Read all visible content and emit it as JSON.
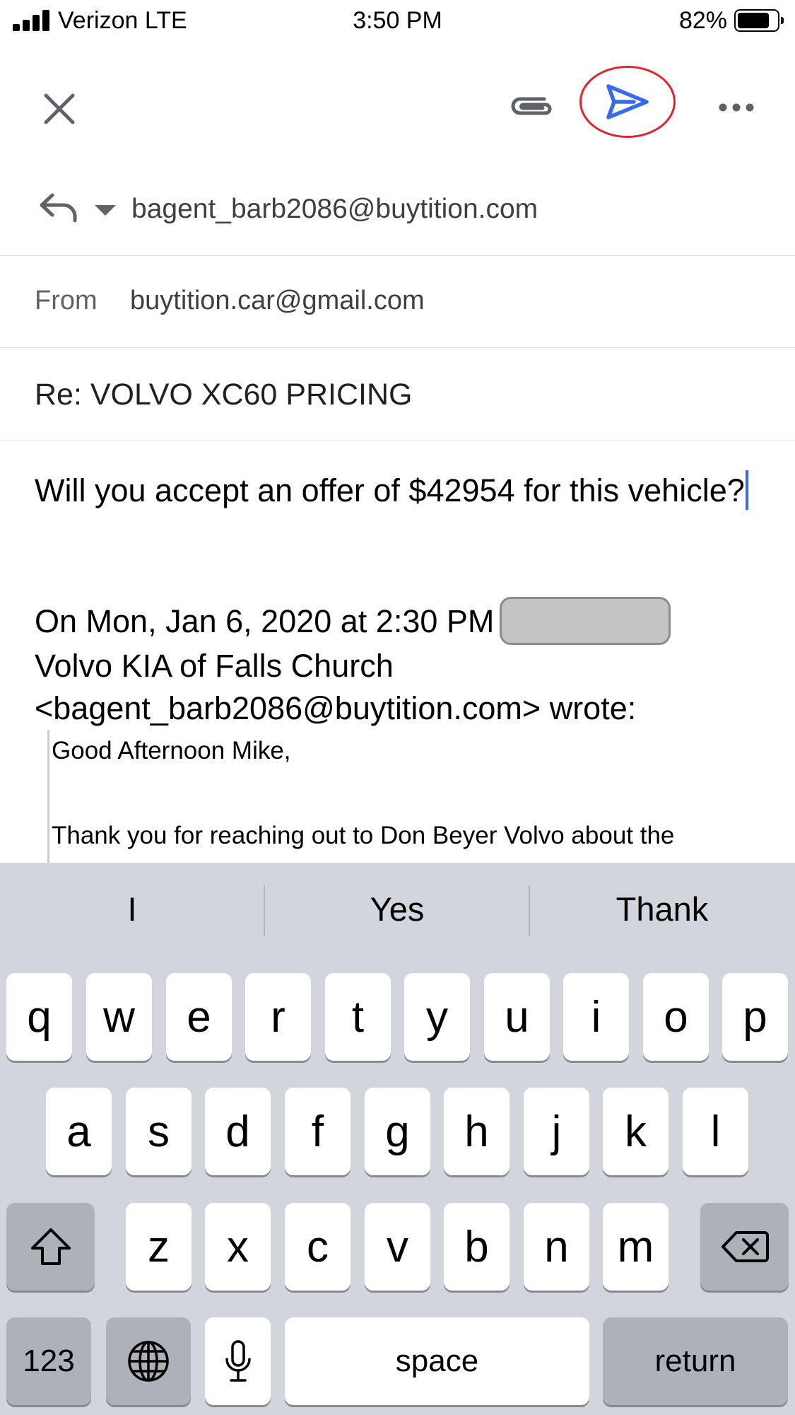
{
  "status_bar": {
    "carrier": "Verizon  LTE",
    "time": "3:50 PM",
    "battery_percent": "82%",
    "battery_level": 0.82,
    "icons": [
      "signal-bars-icon",
      "battery-icon"
    ]
  },
  "toolbar": {
    "icons": [
      "close-icon",
      "attachment-icon",
      "send-icon",
      "more-icon"
    ],
    "accent_color": "#3b6ae8",
    "highlight_color": "#e0242f"
  },
  "compose": {
    "to": "bagent_barb2086@buytition.com",
    "from_label": "From",
    "from": "buytition.car@gmail.com",
    "subject": "Re: VOLVO XC60 PRICING",
    "body": "Will you accept an offer of $42954 for this vehicle?",
    "quote_header_line1": "On Mon, Jan 6, 2020 at 2:30 PM",
    "quote_header_line2": "Volvo KIA of Falls Church",
    "quote_header_line3": "<bagent_barb2086@buytition.com> wrote:",
    "quoted_lines": [
      "Good Afternoon Mike,",
      "Thank you for reaching out to Don Beyer Volvo about the"
    ]
  },
  "keyboard": {
    "suggestions": [
      "I",
      "Yes",
      "Thank"
    ],
    "row1": [
      "q",
      "w",
      "e",
      "r",
      "t",
      "y",
      "u",
      "i",
      "o",
      "p"
    ],
    "row2": [
      "a",
      "s",
      "d",
      "f",
      "g",
      "h",
      "j",
      "k",
      "l"
    ],
    "row3": [
      "z",
      "x",
      "c",
      "v",
      "b",
      "n",
      "m"
    ],
    "numbers_label": "123",
    "space_label": "space",
    "return_label": "return",
    "icons": [
      "shift-icon",
      "backspace-icon",
      "globe-icon",
      "microphone-icon"
    ]
  }
}
